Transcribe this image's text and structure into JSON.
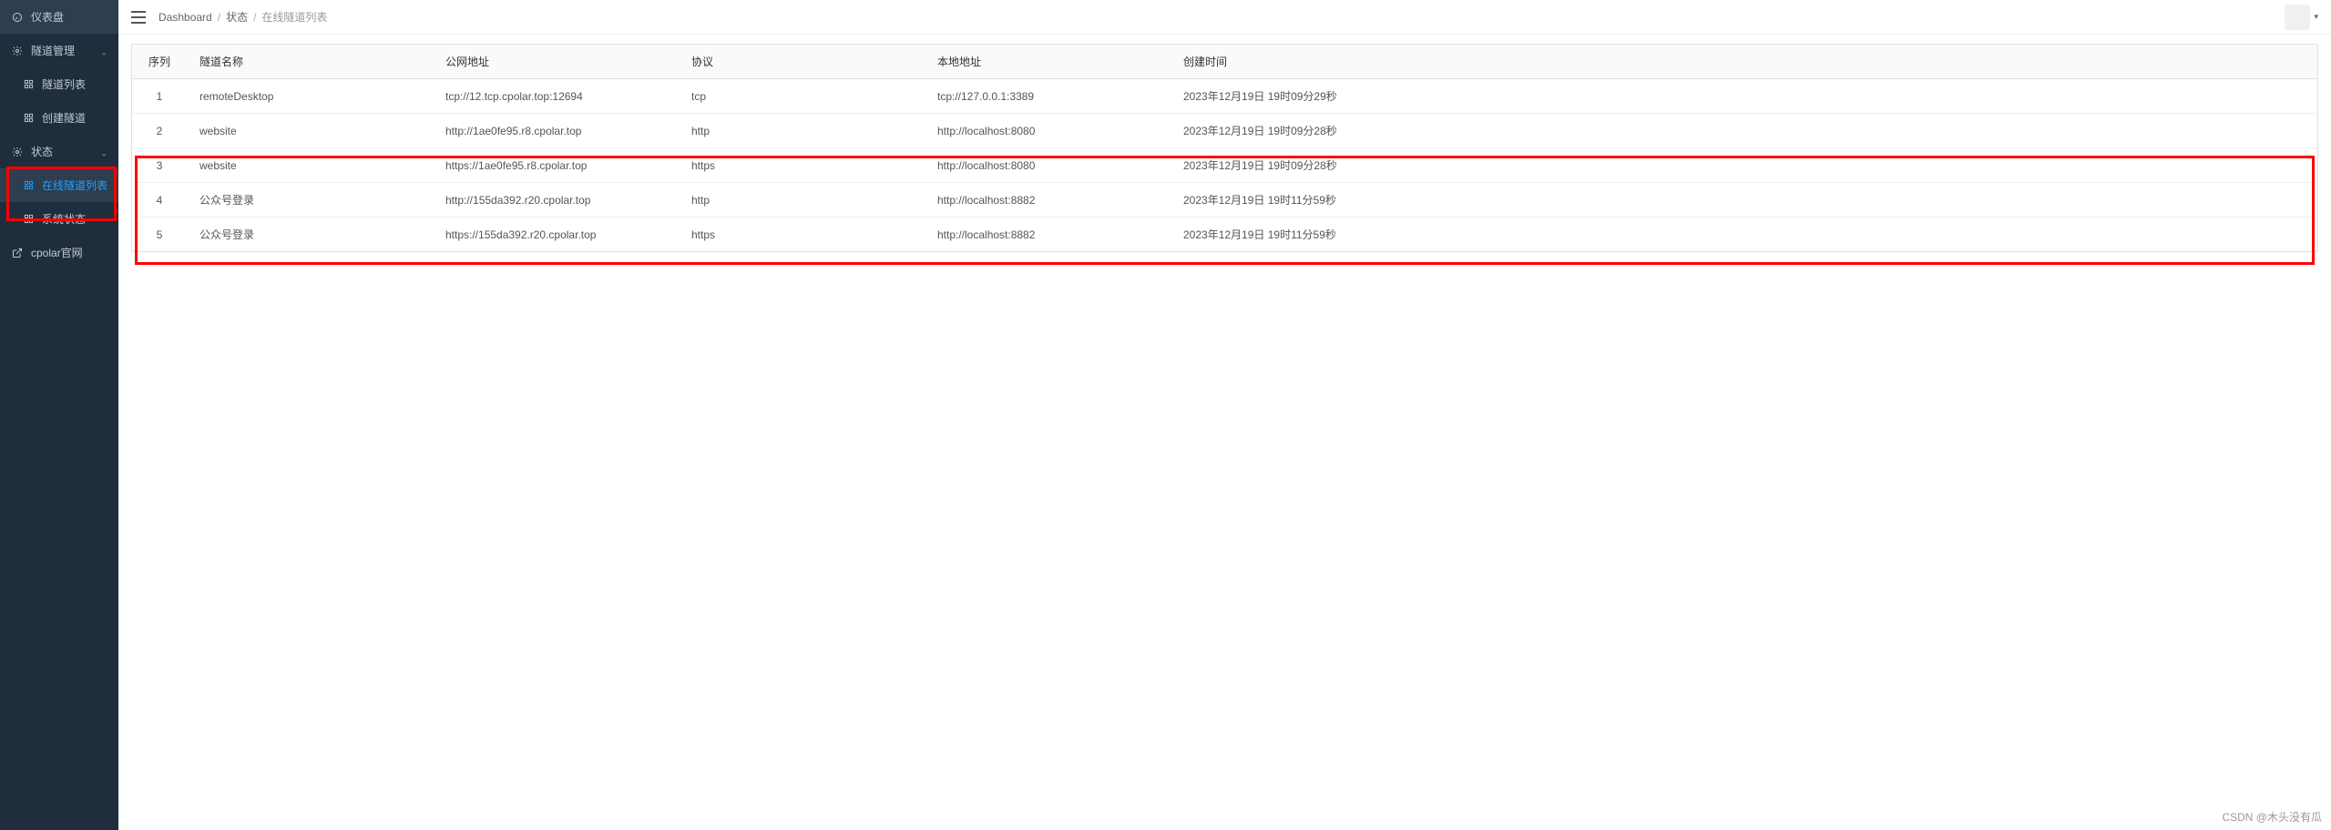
{
  "sidebar": {
    "items": [
      {
        "icon": "dashboard-icon",
        "label": "仪表盘",
        "type": "item"
      },
      {
        "icon": "gear-icon",
        "label": "隧道管理",
        "type": "group",
        "expanded": true
      },
      {
        "icon": "grid-icon",
        "label": "隧道列表",
        "type": "sub"
      },
      {
        "icon": "grid-icon",
        "label": "创建隧道",
        "type": "sub"
      },
      {
        "icon": "gear-icon",
        "label": "状态",
        "type": "group",
        "expanded": true
      },
      {
        "icon": "grid-icon",
        "label": "在线隧道列表",
        "type": "sub",
        "active": true
      },
      {
        "icon": "grid-icon",
        "label": "系统状态",
        "type": "sub"
      },
      {
        "icon": "link-icon",
        "label": "cpolar官网",
        "type": "item"
      }
    ]
  },
  "breadcrumb": {
    "items": [
      "Dashboard",
      "状态",
      "在线隧道列表"
    ]
  },
  "table": {
    "headers": [
      "序列",
      "隧道名称",
      "公网地址",
      "协议",
      "本地地址",
      "创建时间"
    ],
    "rows": [
      {
        "seq": "1",
        "name": "remoteDesktop",
        "url": "tcp://12.tcp.cpolar.top:12694",
        "proto": "tcp",
        "local": "tcp://127.0.0.1:3389",
        "created": "2023年12月19日 19时09分29秒"
      },
      {
        "seq": "2",
        "name": "website",
        "url": "http://1ae0fe95.r8.cpolar.top",
        "proto": "http",
        "local": "http://localhost:8080",
        "created": "2023年12月19日 19时09分28秒"
      },
      {
        "seq": "3",
        "name": "website",
        "url": "https://1ae0fe95.r8.cpolar.top",
        "proto": "https",
        "local": "http://localhost:8080",
        "created": "2023年12月19日 19时09分28秒"
      },
      {
        "seq": "4",
        "name": "公众号登录",
        "url": "http://155da392.r20.cpolar.top",
        "proto": "http",
        "local": "http://localhost:8882",
        "created": "2023年12月19日 19时11分59秒"
      },
      {
        "seq": "5",
        "name": "公众号登录",
        "url": "https://155da392.r20.cpolar.top",
        "proto": "https",
        "local": "http://localhost:8882",
        "created": "2023年12月19日 19时11分59秒"
      }
    ]
  },
  "watermark": "CSDN @木头没有瓜"
}
